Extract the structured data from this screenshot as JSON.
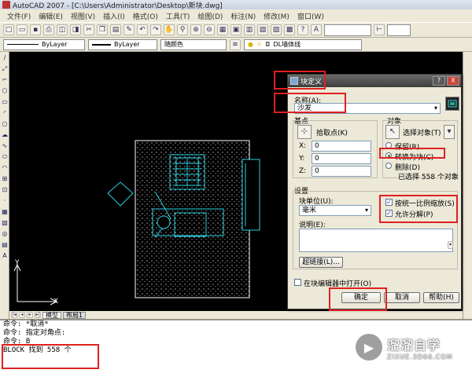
{
  "window": {
    "title": "AutoCAD 2007 - [C:\\Users\\Administrator\\Desktop\\新块.dwg]"
  },
  "menu": [
    "文件(F)",
    "编辑(E)",
    "视图(V)",
    "插入(I)",
    "格式(O)",
    "工具(T)",
    "绘图(D)",
    "标注(N)",
    "修改(M)",
    "窗口(W)"
  ],
  "toolbar": {
    "linetype": "ByLayer",
    "lineweight": "ByLayer",
    "plotstyle": "随颜色",
    "layer": "DL墙体线"
  },
  "layout_tabs": [
    "模型",
    "布局1"
  ],
  "command_lines": [
    "命令: *取消*",
    "命令: 指定对角点:",
    "命令: B",
    "BLOCK 找到 558 个"
  ],
  "watermark": {
    "title": "溜溜自学",
    "subtitle": "ZIXUE.3D66.COM"
  },
  "ucs": {
    "x": "X",
    "y": "Y"
  },
  "dialog": {
    "title": "块定义",
    "help_btn": "?",
    "close_btn": "X",
    "name_label": "名称(A):",
    "name_value": "沙发",
    "basepoint": {
      "group_label": "基点",
      "pick_label": "拾取点(K)",
      "x_label": "X:",
      "x_value": "0",
      "y_label": "Y:",
      "y_value": "0",
      "z_label": "Z:",
      "z_value": "0"
    },
    "objects": {
      "group_label": "对象",
      "select_label": "选择对象(T)",
      "retain": "保留(R)",
      "convert": "转换为块(C)",
      "delete": "删除(D)",
      "selected_info": "已选择 558 个对象"
    },
    "settings": {
      "group_label": "设置",
      "unit_label": "块单位(U):",
      "unit_value": "毫米",
      "desc_label": "说明(E):",
      "scale_uniform": "按统一比例缩放(S)",
      "allow_explode": "允许分解(P)",
      "hyperlink_btn": "超链接(L)..."
    },
    "open_in_editor": "在块编辑器中打开(O)",
    "ok": "确定",
    "cancel": "取消",
    "help": "帮助(H)"
  }
}
